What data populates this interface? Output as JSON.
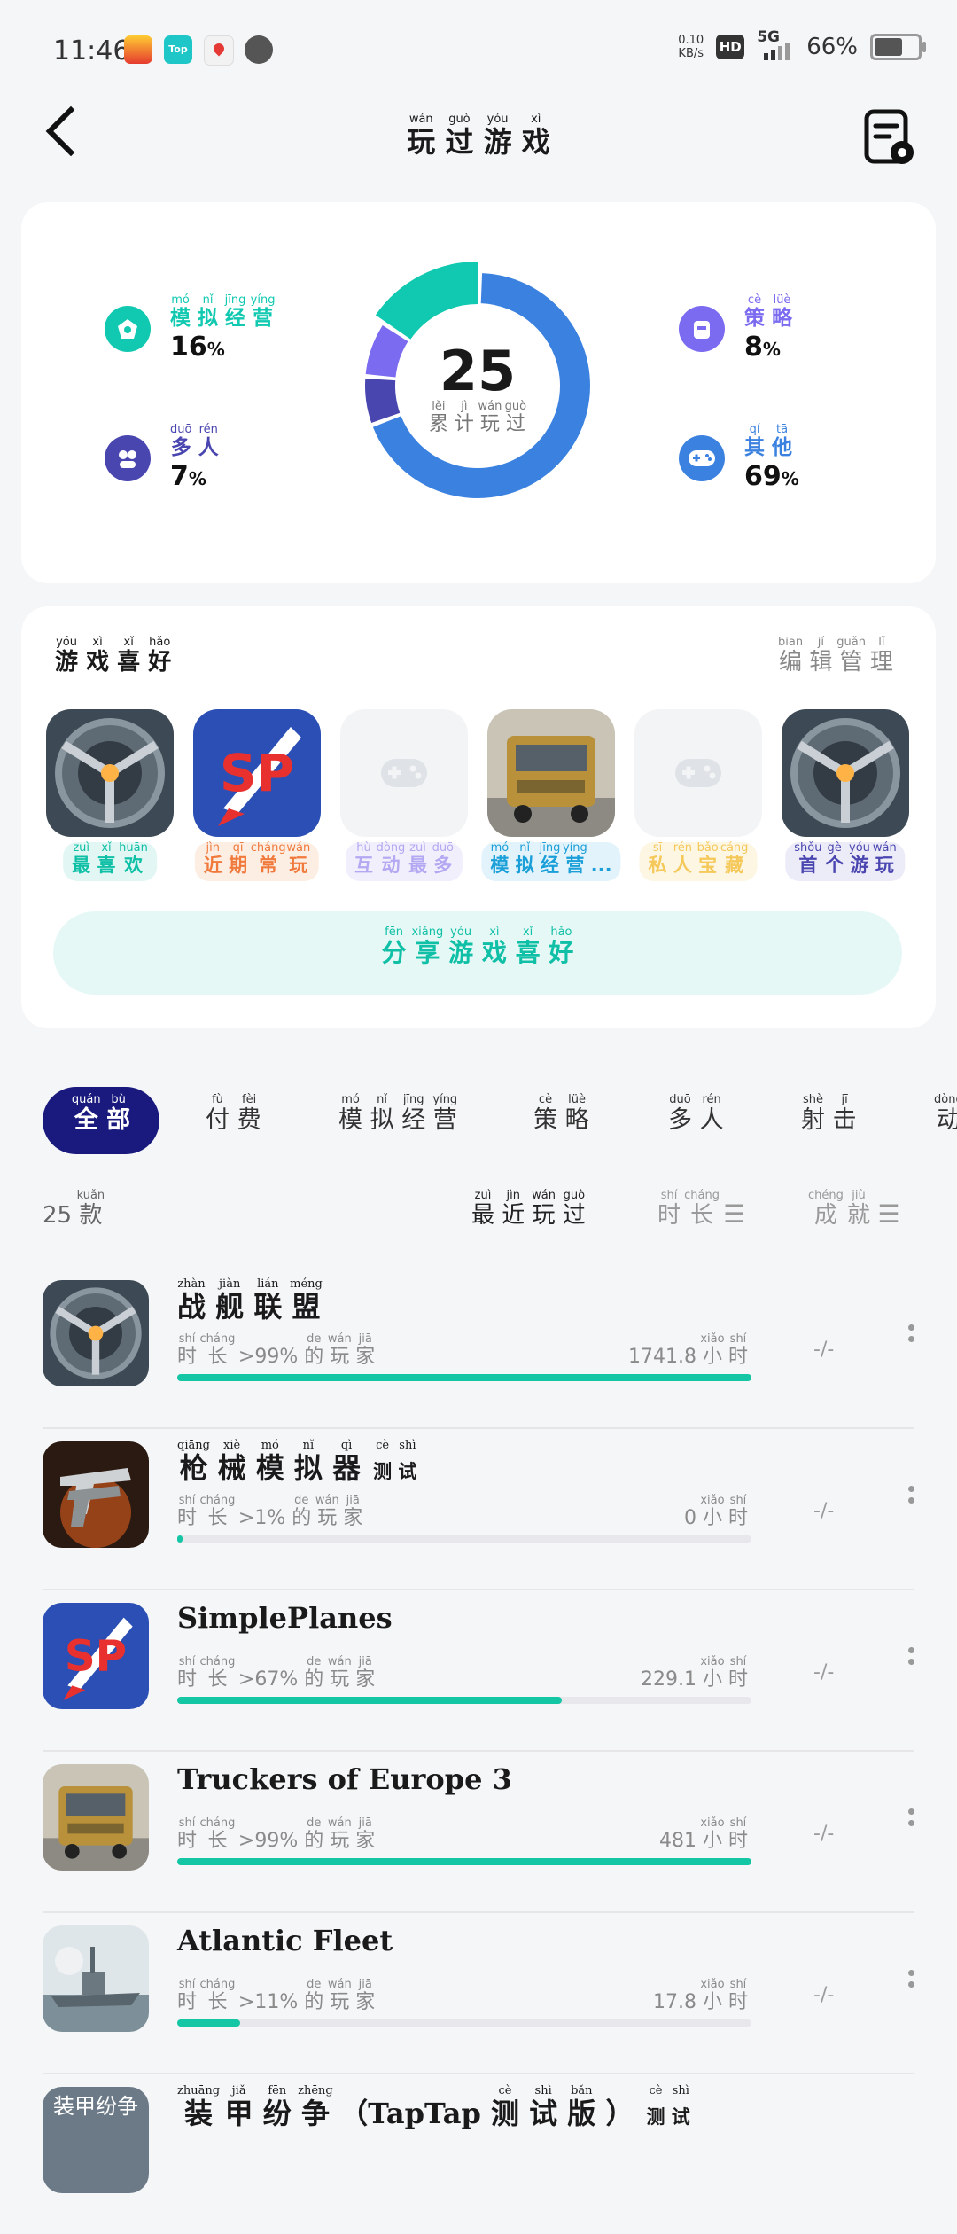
{
  "status": {
    "time": "11:46",
    "net_speed_top": "0.10",
    "net_speed_bottom": "KB/s",
    "hd": "HD",
    "network": "5G",
    "battery": "66%"
  },
  "header": {
    "title": [
      {
        "c": "玩",
        "p": "wán"
      },
      {
        "c": "过",
        "p": "guò"
      },
      {
        "c": "游",
        "p": "yóu"
      },
      {
        "c": "戏",
        "p": "xì"
      }
    ]
  },
  "stats": {
    "total": "25",
    "total_label": [
      {
        "c": "累",
        "p": "lěi"
      },
      {
        "c": "计",
        "p": "jì"
      },
      {
        "c": "玩",
        "p": "wán"
      },
      {
        "c": "过",
        "p": "guò"
      }
    ],
    "genres": [
      {
        "name": [
          {
            "c": "模",
            "p": "mó"
          },
          {
            "c": "拟",
            "p": "nǐ"
          },
          {
            "c": "经",
            "p": "jīng"
          },
          {
            "c": "营",
            "p": "yíng"
          }
        ],
        "percent": "16",
        "color": "#10c9b0",
        "icon": "simulation-icon",
        "share": 16
      },
      {
        "name": [
          {
            "c": "多",
            "p": "duō"
          },
          {
            "c": "人",
            "p": "rén"
          }
        ],
        "percent": "7",
        "color": "#4a46b0",
        "icon": "multiplayer-icon",
        "share": 7
      },
      {
        "name": [
          {
            "c": "策",
            "p": "cè"
          },
          {
            "c": "略",
            "p": "lüè"
          }
        ],
        "percent": "8",
        "color": "#7b6bf0",
        "icon": "strategy-icon",
        "share": 8
      },
      {
        "name": [
          {
            "c": "其",
            "p": "qí"
          },
          {
            "c": "他",
            "p": "tā"
          }
        ],
        "percent": "69",
        "color": "#3b82e0",
        "icon": "gamepad-icon",
        "share": 69
      }
    ]
  },
  "favorites": {
    "title": [
      {
        "c": "游",
        "p": "yóu"
      },
      {
        "c": "戏",
        "p": "xì"
      },
      {
        "c": "喜",
        "p": "xǐ"
      },
      {
        "c": "好",
        "p": "hǎo"
      }
    ],
    "edit": [
      {
        "c": "编",
        "p": "biān"
      },
      {
        "c": "辑",
        "p": "jí"
      },
      {
        "c": "管",
        "p": "guǎn"
      },
      {
        "c": "理",
        "p": "lǐ"
      }
    ],
    "items": [
      {
        "tag": [
          {
            "c": "最",
            "p": "zuì"
          },
          {
            "c": "喜",
            "p": "xǐ"
          },
          {
            "c": "欢",
            "p": "huān"
          }
        ],
        "color": "#10c0a6",
        "bg": "#e2f7f4",
        "icon": "warship-alliance-icon"
      },
      {
        "tag": [
          {
            "c": "近",
            "p": "jìn"
          },
          {
            "c": "期",
            "p": "qī"
          },
          {
            "c": "常",
            "p": "cháng"
          },
          {
            "c": "玩",
            "p": "wán"
          }
        ],
        "color": "#f07a3c",
        "bg": "#fdeee4",
        "icon": "simpleplanes-icon"
      },
      {
        "tag": [
          {
            "c": "互",
            "p": "hù"
          },
          {
            "c": "动",
            "p": "dòng"
          },
          {
            "c": "最",
            "p": "zuì"
          },
          {
            "c": "多",
            "p": "duō"
          }
        ],
        "color": "#b3a8f2",
        "bg": "#f2effd",
        "icon": "placeholder-gamepad-icon"
      },
      {
        "tag": [
          {
            "c": "模",
            "p": "mó"
          },
          {
            "c": "拟",
            "p": "nǐ"
          },
          {
            "c": "经",
            "p": "jīng"
          },
          {
            "c": "营",
            "p": "yíng"
          },
          {
            "c": "...",
            "p": ""
          }
        ],
        "color": "#1a9fd8",
        "bg": "#e3f3fb",
        "icon": "truckers-icon"
      },
      {
        "tag": [
          {
            "c": "私",
            "p": "sī"
          },
          {
            "c": "人",
            "p": "rén"
          },
          {
            "c": "宝",
            "p": "bǎo"
          },
          {
            "c": "藏",
            "p": "cáng"
          }
        ],
        "color": "#f5c85a",
        "bg": "#fdf6e3",
        "icon": "placeholder-gamepad-icon"
      },
      {
        "tag": [
          {
            "c": "首",
            "p": "shǒu"
          },
          {
            "c": "个",
            "p": "gè"
          },
          {
            "c": "游",
            "p": "yóu"
          },
          {
            "c": "玩",
            "p": "wán"
          }
        ],
        "color": "#4a46b0",
        "bg": "#ecebf8",
        "icon": "warship-alliance-icon"
      }
    ],
    "share": [
      {
        "c": "分",
        "p": "fēn"
      },
      {
        "c": "享",
        "p": "xiǎng"
      },
      {
        "c": "游",
        "p": "yóu"
      },
      {
        "c": "戏",
        "p": "xì"
      },
      {
        "c": "喜",
        "p": "xǐ"
      },
      {
        "c": "好",
        "p": "hǎo"
      }
    ]
  },
  "tabs": [
    {
      "label": [
        {
          "c": "全",
          "p": "quán"
        },
        {
          "c": "部",
          "p": "bù"
        }
      ],
      "active": true
    },
    {
      "label": [
        {
          "c": "付",
          "p": "fù"
        },
        {
          "c": "费",
          "p": "fèi"
        }
      ]
    },
    {
      "label": [
        {
          "c": "模",
          "p": "mó"
        },
        {
          "c": "拟",
          "p": "nǐ"
        },
        {
          "c": "经",
          "p": "jīng"
        },
        {
          "c": "营",
          "p": "yíng"
        }
      ]
    },
    {
      "label": [
        {
          "c": "策",
          "p": "cè"
        },
        {
          "c": "略",
          "p": "lüè"
        }
      ]
    },
    {
      "label": [
        {
          "c": "多",
          "p": "duō"
        },
        {
          "c": "人",
          "p": "rén"
        }
      ]
    },
    {
      "label": [
        {
          "c": "射",
          "p": "shè"
        },
        {
          "c": "击",
          "p": "jī"
        }
      ]
    },
    {
      "label": [
        {
          "c": "动",
          "p": "dòng"
        }
      ]
    }
  ],
  "list_header": {
    "count": "25",
    "count_unit": [
      {
        "c": "款",
        "p": "kuǎn"
      }
    ],
    "sort_recent": [
      {
        "c": "最",
        "p": "zuì"
      },
      {
        "c": "近",
        "p": "jìn"
      },
      {
        "c": "玩",
        "p": "wán"
      },
      {
        "c": "过",
        "p": "guò"
      }
    ],
    "sort_duration": [
      {
        "c": "时",
        "p": "shí"
      },
      {
        "c": "长",
        "p": "cháng"
      }
    ],
    "sort_achievement": [
      {
        "c": "成",
        "p": "chéng"
      },
      {
        "c": "就",
        "p": "jiù"
      }
    ]
  },
  "games": [
    {
      "name_ruby": [
        {
          "c": "战",
          "p": "zhàn"
        },
        {
          "c": "舰",
          "p": "jiàn"
        },
        {
          "c": "联",
          "p": "lián"
        },
        {
          "c": "盟",
          "p": "méng"
        }
      ],
      "name": "",
      "test": null,
      "percent_label": ">99%",
      "progress": 1.0,
      "hours": "1741.8",
      "achievement": "-/-",
      "icon": "warship-alliance-icon"
    },
    {
      "name_ruby": [
        {
          "c": "枪",
          "p": "qiāng"
        },
        {
          "c": "械",
          "p": "xiè"
        },
        {
          "c": "模",
          "p": "mó"
        },
        {
          "c": "拟",
          "p": "nǐ"
        },
        {
          "c": "器",
          "p": "qì"
        }
      ],
      "name": "",
      "test": [
        {
          "c": "测",
          "p": "cè"
        },
        {
          "c": "试",
          "p": "shì"
        }
      ],
      "percent_label": ">1%",
      "progress": 0.01,
      "hours": "0",
      "achievement": "-/-",
      "icon": "gun-simulator-icon"
    },
    {
      "name_ruby": null,
      "name": "SimplePlanes",
      "test": null,
      "percent_label": ">67%",
      "progress": 0.67,
      "hours": "229.1",
      "achievement": "-/-",
      "icon": "simpleplanes-icon"
    },
    {
      "name_ruby": null,
      "name": "Truckers of Europe 3",
      "test": null,
      "percent_label": ">99%",
      "progress": 1.0,
      "hours": "481",
      "achievement": "-/-",
      "icon": "truckers-icon"
    },
    {
      "name_ruby": null,
      "name": "Atlantic Fleet",
      "test": null,
      "percent_label": ">11%",
      "progress": 0.11,
      "hours": "17.8",
      "achievement": "-/-",
      "icon": "atlantic-fleet-icon"
    },
    {
      "name_ruby": [
        {
          "c": "装",
          "p": "zhuāng"
        },
        {
          "c": "甲",
          "p": "jiǎ"
        },
        {
          "c": "纷",
          "p": "fēn"
        },
        {
          "c": "争",
          "p": "zhēng"
        },
        {
          "c": "（TapTap",
          "p": ""
        },
        {
          "c": "测",
          "p": "cè"
        },
        {
          "c": "试",
          "p": "shì"
        },
        {
          "c": "版",
          "p": "bǎn"
        },
        {
          "c": "）",
          "p": ""
        }
      ],
      "name": "",
      "test": [
        {
          "c": "测",
          "p": "cè"
        },
        {
          "c": "试",
          "p": "shì"
        }
      ],
      "percent_label": "",
      "progress": 0,
      "hours": "",
      "achievement": "",
      "icon": "armored-warfare-icon",
      "icon_text": "装甲纷争"
    }
  ],
  "row_labels": {
    "duration": [
      {
        "c": "时",
        "p": "shí"
      },
      {
        "c": "长",
        "p": "cháng"
      }
    ],
    "of_players": [
      {
        "c": "的",
        "p": "de"
      },
      {
        "c": "玩",
        "p": "wán"
      },
      {
        "c": "家",
        "p": "jiā"
      }
    ],
    "hours_unit": [
      {
        "c": "小",
        "p": "xiǎo"
      },
      {
        "c": "时",
        "p": "shí"
      }
    ]
  }
}
